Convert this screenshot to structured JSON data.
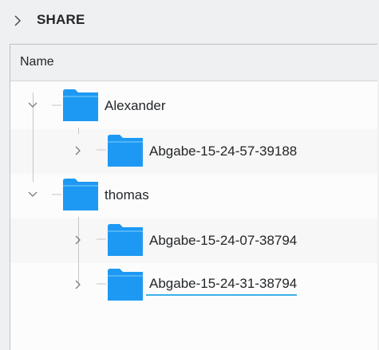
{
  "breadcrumb": {
    "label": "SHARE"
  },
  "view": {
    "column_name": "Name"
  },
  "tree": [
    {
      "label": "Alexander",
      "type": "folder",
      "state": "expanded"
    },
    {
      "label": "Abgabe-15-24-57-39188",
      "type": "folder",
      "state": "collapsed"
    },
    {
      "label": "thomas",
      "type": "folder",
      "state": "expanded"
    },
    {
      "label": "Abgabe-15-24-07-38794",
      "type": "folder",
      "state": "collapsed"
    },
    {
      "label": "Abgabe-15-24-31-38794",
      "type": "folder",
      "state": "collapsed",
      "hovered": true
    }
  ],
  "colors": {
    "folder": "#1d99f3",
    "accent": "#3daee9",
    "text": "#232629"
  }
}
